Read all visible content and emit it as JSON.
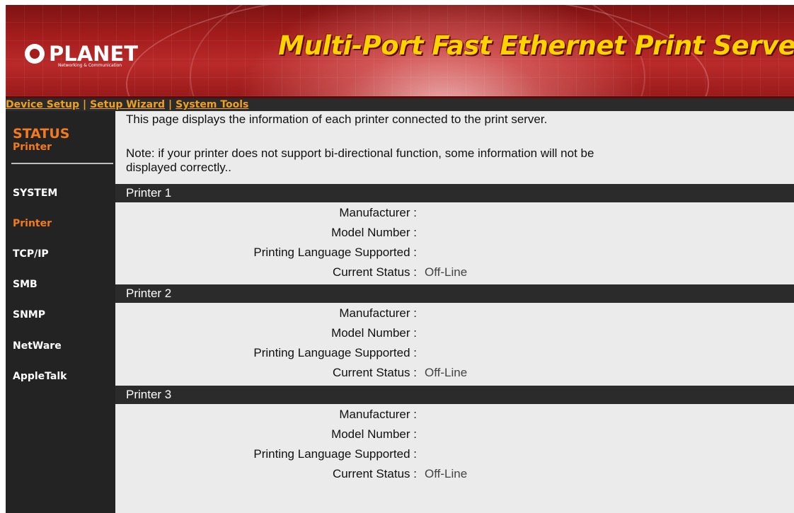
{
  "banner": {
    "logo_text": "PLANET",
    "logo_tagline": "Networking & Communication",
    "title": "Multi-Port Fast Ethernet Print Server"
  },
  "topnav": {
    "items": [
      "Device Setup",
      "Setup Wizard",
      "System Tools"
    ],
    "separator": "|"
  },
  "sidebar": {
    "heading": "STATUS",
    "subheading": "Printer",
    "items": [
      {
        "label": "SYSTEM",
        "active": false
      },
      {
        "label": "Printer",
        "active": true
      },
      {
        "label": "TCP/IP",
        "active": false
      },
      {
        "label": "SMB",
        "active": false
      },
      {
        "label": "SNMP",
        "active": false
      },
      {
        "label": "NetWare",
        "active": false
      },
      {
        "label": "AppleTalk",
        "active": false
      }
    ]
  },
  "main": {
    "intro": "This page displays the information of each printer connected to the print server.",
    "note_line1": "Note: if your printer does not support bi-directional function, some information will not be",
    "note_line2": "displayed correctly..",
    "field_labels": {
      "manufacturer": "Manufacturer :",
      "model": "Model Number :",
      "language": "Printing Language Supported :",
      "status": "Current Status :"
    },
    "printers": [
      {
        "name": "Printer 1",
        "manufacturer": "",
        "model": "",
        "language": "",
        "status": "Off-Line"
      },
      {
        "name": "Printer 2",
        "manufacturer": "",
        "model": "",
        "language": "",
        "status": "Off-Line"
      },
      {
        "name": "Printer 3",
        "manufacturer": "",
        "model": "",
        "language": "",
        "status": "Off-Line"
      }
    ]
  },
  "colors": {
    "accent_orange": "#f47a1f",
    "nav_link": "#f0a020",
    "banner_title": "#ffd200",
    "dark_bar": "#2b2b2b"
  }
}
